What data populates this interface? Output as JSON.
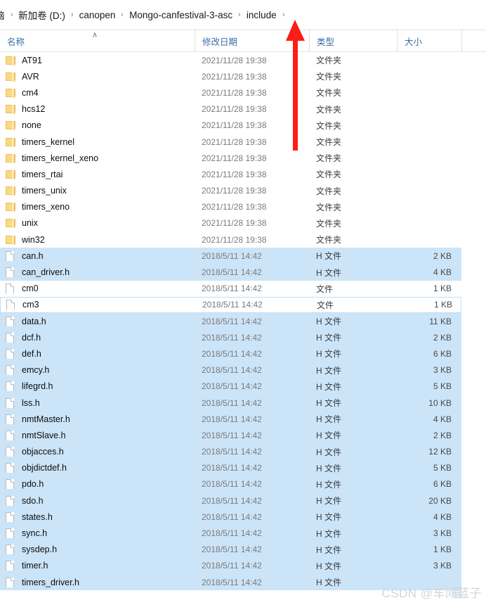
{
  "window": {
    "app": "windows-file-explorer"
  },
  "breadcrumb": {
    "separator": "›",
    "items": [
      {
        "label": "脑",
        "clipped": true
      },
      {
        "label": "新加卷 (D:)",
        "clipped": false
      },
      {
        "label": "canopen",
        "clipped": false
      },
      {
        "label": "Mongo-canfestival-3-asc",
        "clipped": false
      },
      {
        "label": "include",
        "clipped": false
      }
    ],
    "trailing_separator": "›"
  },
  "columns": {
    "name": "名称",
    "date": "修改日期",
    "type": "类型",
    "size": "大小",
    "sort_indicator": "∧"
  },
  "colors": {
    "selection": "#cce4f7",
    "header_text": "#3a6ea5",
    "folder_icon": "#fbd881",
    "annotation_arrow": "#fc1d16"
  },
  "annotation": {
    "arrow": "up-arrow",
    "points_to": "include"
  },
  "watermark": {
    "prefix": "CSDN @车间",
    "overlap_a": "禀",
    "overlap_b": "蓝子"
  },
  "rows": [
    {
      "icon": "folder-icon",
      "name": "AT91",
      "date": "2021/11/28 19:38",
      "type": "文件夹",
      "size": "",
      "state": "plain"
    },
    {
      "icon": "folder-icon",
      "name": "AVR",
      "date": "2021/11/28 19:38",
      "type": "文件夹",
      "size": "",
      "state": "plain"
    },
    {
      "icon": "folder-icon",
      "name": "cm4",
      "date": "2021/11/28 19:38",
      "type": "文件夹",
      "size": "",
      "state": "plain"
    },
    {
      "icon": "folder-icon",
      "name": "hcs12",
      "date": "2021/11/28 19:38",
      "type": "文件夹",
      "size": "",
      "state": "plain"
    },
    {
      "icon": "folder-icon",
      "name": "none",
      "date": "2021/11/28 19:38",
      "type": "文件夹",
      "size": "",
      "state": "plain"
    },
    {
      "icon": "folder-icon",
      "name": "timers_kernel",
      "date": "2021/11/28 19:38",
      "type": "文件夹",
      "size": "",
      "state": "plain"
    },
    {
      "icon": "folder-icon",
      "name": "timers_kernel_xeno",
      "date": "2021/11/28 19:38",
      "type": "文件夹",
      "size": "",
      "state": "plain"
    },
    {
      "icon": "folder-icon",
      "name": "timers_rtai",
      "date": "2021/11/28 19:38",
      "type": "文件夹",
      "size": "",
      "state": "plain"
    },
    {
      "icon": "folder-icon",
      "name": "timers_unix",
      "date": "2021/11/28 19:38",
      "type": "文件夹",
      "size": "",
      "state": "plain"
    },
    {
      "icon": "folder-icon",
      "name": "timers_xeno",
      "date": "2021/11/28 19:38",
      "type": "文件夹",
      "size": "",
      "state": "plain"
    },
    {
      "icon": "folder-icon",
      "name": "unix",
      "date": "2021/11/28 19:38",
      "type": "文件夹",
      "size": "",
      "state": "plain"
    },
    {
      "icon": "folder-icon",
      "name": "win32",
      "date": "2021/11/28 19:38",
      "type": "文件夹",
      "size": "",
      "state": "plain"
    },
    {
      "icon": "file-icon",
      "name": "can.h",
      "date": "2018/5/11 14:42",
      "type": "H 文件",
      "size": "2 KB",
      "state": "selected"
    },
    {
      "icon": "file-icon",
      "name": "can_driver.h",
      "date": "2018/5/11 14:42",
      "type": "H 文件",
      "size": "4 KB",
      "state": "selected"
    },
    {
      "icon": "file-icon",
      "name": "cm0",
      "date": "2018/5/11 14:42",
      "type": "文件",
      "size": "1 KB",
      "state": "plain"
    },
    {
      "icon": "file-icon",
      "name": "cm3",
      "date": "2018/5/11 14:42",
      "type": "文件",
      "size": "1 KB",
      "state": "focused"
    },
    {
      "icon": "file-icon",
      "name": "data.h",
      "date": "2018/5/11 14:42",
      "type": "H 文件",
      "size": "11 KB",
      "state": "selected"
    },
    {
      "icon": "file-icon",
      "name": "dcf.h",
      "date": "2018/5/11 14:42",
      "type": "H 文件",
      "size": "2 KB",
      "state": "selected"
    },
    {
      "icon": "file-icon",
      "name": "def.h",
      "date": "2018/5/11 14:42",
      "type": "H 文件",
      "size": "6 KB",
      "state": "selected"
    },
    {
      "icon": "file-icon",
      "name": "emcy.h",
      "date": "2018/5/11 14:42",
      "type": "H 文件",
      "size": "3 KB",
      "state": "selected"
    },
    {
      "icon": "file-icon",
      "name": "lifegrd.h",
      "date": "2018/5/11 14:42",
      "type": "H 文件",
      "size": "5 KB",
      "state": "selected"
    },
    {
      "icon": "file-icon",
      "name": "lss.h",
      "date": "2018/5/11 14:42",
      "type": "H 文件",
      "size": "10 KB",
      "state": "selected"
    },
    {
      "icon": "file-icon",
      "name": "nmtMaster.h",
      "date": "2018/5/11 14:42",
      "type": "H 文件",
      "size": "4 KB",
      "state": "selected"
    },
    {
      "icon": "file-icon",
      "name": "nmtSlave.h",
      "date": "2018/5/11 14:42",
      "type": "H 文件",
      "size": "2 KB",
      "state": "selected"
    },
    {
      "icon": "file-icon",
      "name": "objacces.h",
      "date": "2018/5/11 14:42",
      "type": "H 文件",
      "size": "12 KB",
      "state": "selected"
    },
    {
      "icon": "file-icon",
      "name": "objdictdef.h",
      "date": "2018/5/11 14:42",
      "type": "H 文件",
      "size": "5 KB",
      "state": "selected"
    },
    {
      "icon": "file-icon",
      "name": "pdo.h",
      "date": "2018/5/11 14:42",
      "type": "H 文件",
      "size": "6 KB",
      "state": "selected"
    },
    {
      "icon": "file-icon",
      "name": "sdo.h",
      "date": "2018/5/11 14:42",
      "type": "H 文件",
      "size": "20 KB",
      "state": "selected"
    },
    {
      "icon": "file-icon",
      "name": "states.h",
      "date": "2018/5/11 14:42",
      "type": "H 文件",
      "size": "4 KB",
      "state": "selected"
    },
    {
      "icon": "file-icon",
      "name": "sync.h",
      "date": "2018/5/11 14:42",
      "type": "H 文件",
      "size": "3 KB",
      "state": "selected"
    },
    {
      "icon": "file-icon",
      "name": "sysdep.h",
      "date": "2018/5/11 14:42",
      "type": "H 文件",
      "size": "1 KB",
      "state": "selected"
    },
    {
      "icon": "file-icon",
      "name": "timer.h",
      "date": "2018/5/11 14:42",
      "type": "H 文件",
      "size": "3 KB",
      "state": "selected"
    },
    {
      "icon": "file-icon",
      "name": "timers_driver.h",
      "date": "2018/5/11 14:42",
      "type": "H 文件",
      "size": "",
      "state": "selected"
    }
  ]
}
